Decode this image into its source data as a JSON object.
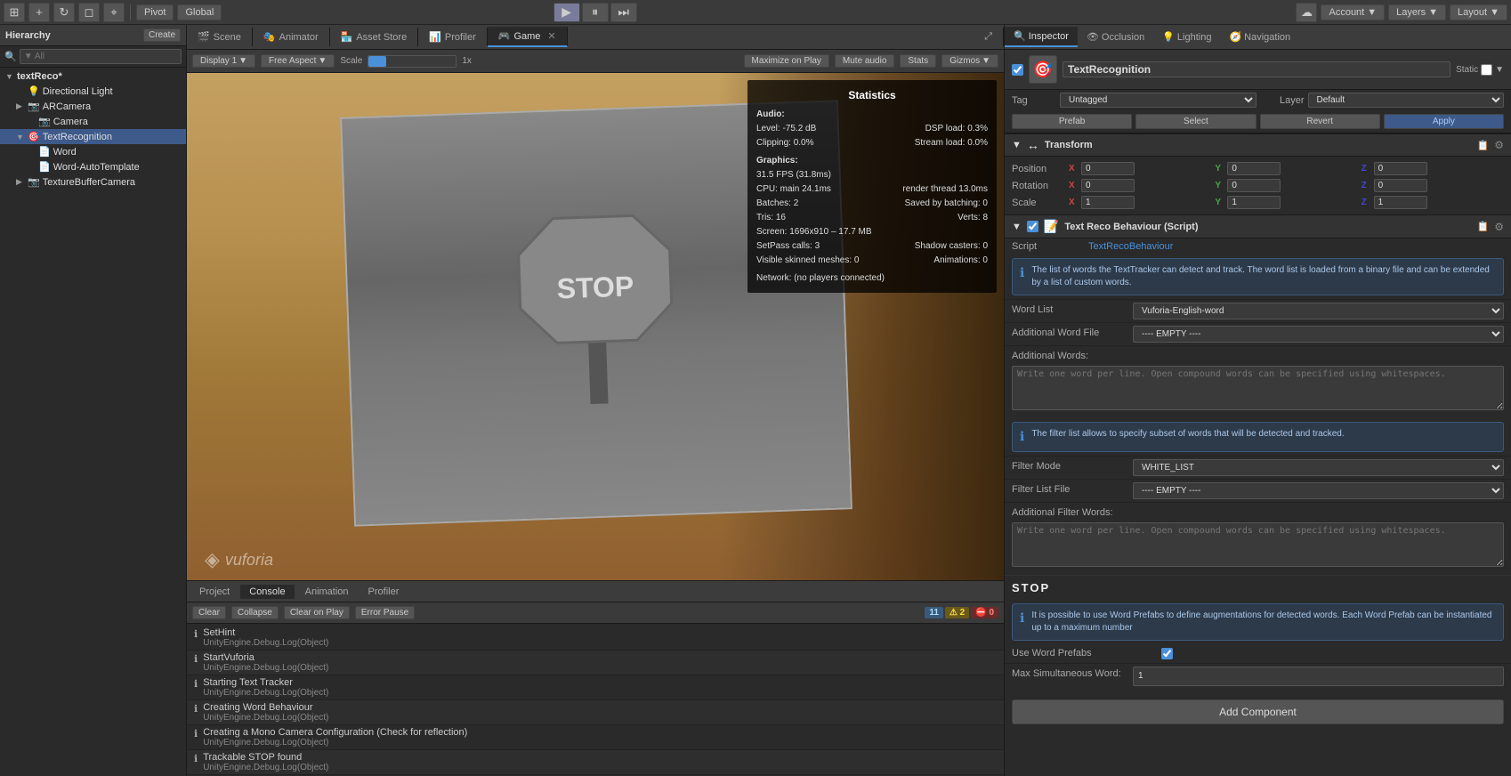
{
  "toolbar": {
    "pivot_label": "Pivot",
    "global_label": "Global",
    "account_label": "Account",
    "layers_label": "Layers",
    "layout_label": "Layout"
  },
  "scene_tabs": [
    {
      "label": "Scene",
      "icon": "🎬",
      "active": false
    },
    {
      "label": "Animator",
      "icon": "🎭",
      "active": false
    },
    {
      "label": "Asset Store",
      "icon": "🏪",
      "active": false
    },
    {
      "label": "Profiler",
      "icon": "📊",
      "active": false
    },
    {
      "label": "Game",
      "icon": "🎮",
      "active": true
    }
  ],
  "game_toolbar": {
    "display": "Display 1",
    "aspect": "Free Aspect",
    "scale_label": "Scale",
    "scale_val": "1x",
    "maximize": "Maximize on Play",
    "mute_audio": "Mute audio",
    "stats": "Stats",
    "gizmos": "Gizmos"
  },
  "statistics": {
    "title": "Statistics",
    "audio_label": "Audio:",
    "level": "Level: -75.2 dB",
    "dsp_load": "DSP load: 0.3%",
    "clipping": "Clipping: 0.0%",
    "stream_load": "Stream load: 0.0%",
    "graphics_label": "Graphics:",
    "fps": "31.5 FPS (31.8ms)",
    "cpu": "CPU: main 24.1ms",
    "render_thread": "render thread 13.0ms",
    "batches": "Batches: 2",
    "saved_batching": "Saved by batching: 0",
    "tris": "Tris: 16",
    "verts": "Verts: 8",
    "screen": "Screen: 1696x910 – 17.7 MB",
    "setpass": "SetPass calls: 3",
    "shadow_casters": "Shadow casters: 0",
    "visible_skinned": "Visible skinned meshes: 0",
    "animations": "Animations: 0",
    "network": "Network: (no players connected)"
  },
  "vuforia": "vuforia",
  "hierarchy": {
    "title": "Hierarchy",
    "create_label": "Create",
    "search_placeholder": "▼ All",
    "items": [
      {
        "id": "textreco",
        "label": "textReco*",
        "indent": 0,
        "selected": false,
        "bold": true,
        "arrow": "▼"
      },
      {
        "id": "dirlight",
        "label": "Directional Light",
        "indent": 1,
        "selected": false,
        "bold": false,
        "arrow": ""
      },
      {
        "id": "arcamera",
        "label": "ARCamera",
        "indent": 1,
        "selected": false,
        "bold": false,
        "arrow": "▶"
      },
      {
        "id": "camera",
        "label": "Camera",
        "indent": 2,
        "selected": false,
        "bold": false,
        "arrow": ""
      },
      {
        "id": "textrec",
        "label": "TextRecognition",
        "indent": 1,
        "selected": true,
        "bold": false,
        "arrow": "▼"
      },
      {
        "id": "word",
        "label": "Word",
        "indent": 2,
        "selected": false,
        "bold": false,
        "arrow": ""
      },
      {
        "id": "word-auto",
        "label": "Word-AutoTemplate",
        "indent": 2,
        "selected": false,
        "bold": false,
        "arrow": ""
      },
      {
        "id": "texturebuf",
        "label": "TextureBufferCamera",
        "indent": 1,
        "selected": false,
        "bold": false,
        "arrow": "▶"
      }
    ]
  },
  "console": {
    "tabs": [
      {
        "label": "Project",
        "active": false
      },
      {
        "label": "Console",
        "active": true
      },
      {
        "label": "Animation",
        "active": false
      },
      {
        "label": "Profiler",
        "active": false
      }
    ],
    "toolbar": {
      "clear": "Clear",
      "collapse": "Collapse",
      "clear_on_play": "Clear on Play",
      "error_pause": "Error Pause"
    },
    "counts": {
      "info": "11",
      "warn": "2",
      "error": "0"
    },
    "logs": [
      {
        "type": "info",
        "main": "SetHint",
        "sub": "UnityEngine.Debug.Log(Object)"
      },
      {
        "type": "info",
        "main": "StartVuforia",
        "sub": "UnityEngine.Debug.Log(Object)"
      },
      {
        "type": "info",
        "main": "Starting Text Tracker",
        "sub": "UnityEngine.Debug.Log(Object)"
      },
      {
        "type": "info",
        "main": "Creating Word Behaviour",
        "sub": "UnityEngine.Debug.Log(Object)"
      },
      {
        "type": "info",
        "main": "Creating a Mono Camera Configuration (Check for reflection)",
        "sub": "UnityEngine.Debug.Log(Object)"
      },
      {
        "type": "info",
        "main": "Trackable STOP found",
        "sub": "UnityEngine.Debug.Log(Object)"
      }
    ]
  },
  "inspector": {
    "title": "Inspector",
    "tabs": [
      {
        "label": "Inspector",
        "active": true,
        "icon": "🔍"
      },
      {
        "label": "Occlusion",
        "active": false,
        "icon": "👁"
      },
      {
        "label": "Lighting",
        "active": false,
        "icon": "💡"
      },
      {
        "label": "Navigation",
        "active": false,
        "icon": "🧭"
      }
    ],
    "obj_name": "TextRecognition",
    "static_label": "Static",
    "tag_label": "Tag",
    "tag_val": "Untagged",
    "layer_label": "Layer",
    "layer_val": "Default",
    "prefab_select": "Prefab",
    "prefab_revert": "Revert",
    "prefab_apply": "Apply",
    "transform": {
      "title": "Transform",
      "position": {
        "label": "Position",
        "x": "0",
        "y": "0",
        "z": "0"
      },
      "rotation": {
        "label": "Rotation",
        "x": "0",
        "y": "0",
        "z": "0"
      },
      "scale": {
        "label": "Scale",
        "x": "1",
        "y": "1",
        "z": "1"
      }
    },
    "script_comp": {
      "title": "Text Reco Behaviour (Script)",
      "script_label": "Script",
      "script_val": "TextRecoBehaviour",
      "info1": "The list of words the TextTracker can detect and track. The word list is loaded from a binary file and can be extended by a list of custom words.",
      "word_list_label": "Word List",
      "word_list_val": "Vuforia-English-word",
      "add_word_file_label": "Additional Word File",
      "add_word_file_val": "---- EMPTY ----",
      "add_words_label": "Additional Words:",
      "add_words_placeholder": "Write one word per line. Open compound words can be specified using whitespaces.",
      "info2": "The filter list allows to specify subset of words that will be detected and tracked.",
      "filter_mode_label": "Filter Mode",
      "filter_mode_val": "WHITE_LIST",
      "filter_file_label": "Filter List File",
      "filter_file_val": "---- EMPTY ----",
      "add_filter_label": "Additional Filter Words:",
      "add_filter_placeholder": "Write one word per line. Open compound words can be specified using whitespaces.",
      "stop_label": "STOP",
      "info3": "It is possible to use Word Prefabs to define augmentations for detected words. Each Word Prefab can be instantiated up to a maximum number",
      "use_word_label": "Use Word Prefabs",
      "use_word_checked": true,
      "max_simult_label": "Max Simultaneous Word:",
      "max_simult_val": "1"
    },
    "add_component": "Add Component"
  }
}
